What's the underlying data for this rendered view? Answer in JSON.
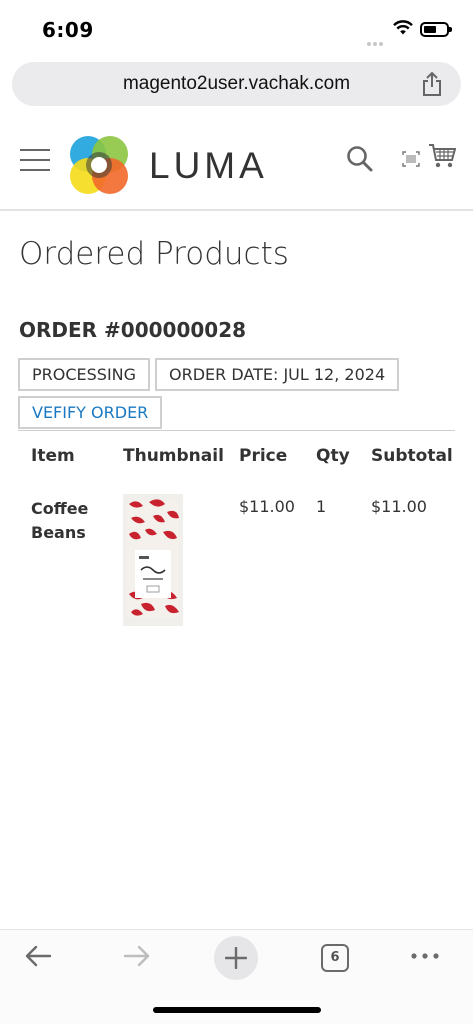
{
  "status_bar": {
    "time": "6:09"
  },
  "browser": {
    "url": "magento2user.vachak.com",
    "tab_count": "6"
  },
  "header": {
    "brand": "LUMA",
    "icons": [
      "menu-icon",
      "luma-logo",
      "search-icon",
      "barcode-scan-icon",
      "cart-icon"
    ]
  },
  "page": {
    "title": "Ordered Products",
    "order_number": "ORDER #000000028",
    "status_tag": "PROCESSING",
    "order_date_tag": "ORDER DATE: JUL 12, 2024",
    "verify_link": "VEFIFY ORDER"
  },
  "table": {
    "headers": [
      "Item",
      "Thumbnail",
      "Price",
      "Qty",
      "Subtotal"
    ],
    "rows": [
      {
        "item": "Coffee Beans",
        "price": "$11.00",
        "qty": "1",
        "subtotal": "$11.00"
      }
    ]
  },
  "colors": {
    "link": "#1979c3",
    "text": "#333333",
    "url_bar": "#ebebed"
  }
}
